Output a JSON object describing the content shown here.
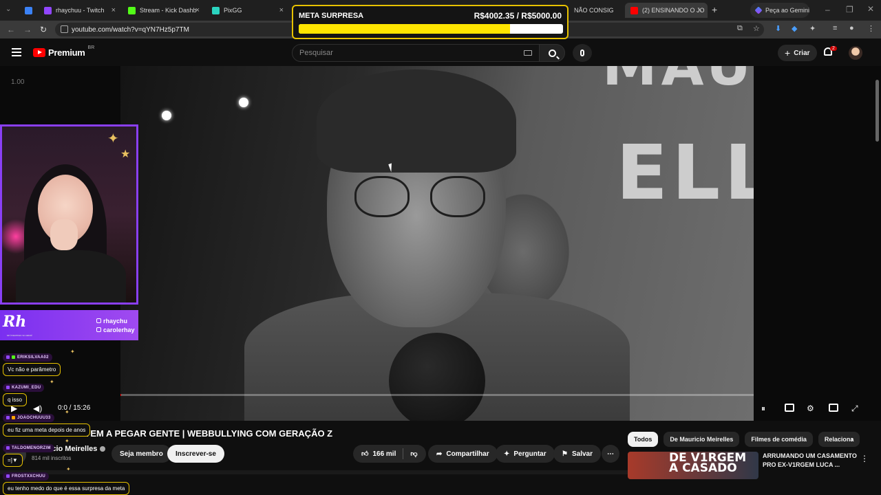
{
  "browser": {
    "tabs": [
      {
        "label": "rhaychuu - Twitch",
        "color": "#9146ff"
      },
      {
        "label": "Stream - Kick Dashb",
        "color": "#53fc18"
      },
      {
        "label": "PixGG",
        "color": "#2bd4c0"
      },
      {
        "label": "NÃO CONSIG",
        "color": "#888888"
      },
      {
        "label": "(2) ENSINANDO O JO",
        "color": "#ff0000"
      }
    ],
    "gemini_label": "Peça ao Gemini",
    "url": "youtube.com/watch?v=qYN7Hz5p7TM"
  },
  "meta": {
    "title": "META SURPRESA",
    "values": "R$4002.35 / R$5000.00",
    "current": 4002.35,
    "goal": 5000.0,
    "accent": "#ffe500"
  },
  "youtube": {
    "logo": "Premium",
    "region": "BR",
    "search_placeholder": "Pesquisar",
    "create_label": "Criar",
    "notif_count": "2"
  },
  "player": {
    "speed": "1.00",
    "time": "0:0  / 15:26",
    "progress_fraction": 0.001,
    "wall_text_top": "MAURI",
    "wall_text": "ELL",
    "watched_icons": [
      "play-icon",
      "volume-icon",
      "autoplay-toggle-icon",
      "subtitles-icon",
      "settings-icon",
      "miniplayer-icon",
      "fullscreen-icon"
    ]
  },
  "stream_overlay": {
    "banner_logo": "Rh",
    "banner_small": "se inscreva no canal",
    "handles": [
      "rhaychu",
      "carolerhay"
    ],
    "border_color": "#8a3ff5"
  },
  "chat": [
    {
      "user": "ERIKSILVAA02",
      "text": "Vc não e parâmetro"
    },
    {
      "user": "KAZUMI_EDU",
      "text": "q isso"
    },
    {
      "user": "JOAOCHUUU33",
      "text": "eu fiz uma meta depois de anos"
    },
    {
      "user": "TALDOMENORZIM",
      "text": "=]▼"
    },
    {
      "user": "FROSTXXCHUU",
      "text": "eu tenho medo do que é essa surpresa da meta"
    }
  ],
  "video": {
    "title": "ENSINANDO O JOVEM A PEGAR GENTE | WEBBULLYING COM GERAÇÃO Z",
    "channel": "Maurício Meirelles",
    "subscribers": "814 mil inscritos",
    "member_label": "Seja membro",
    "subscribe_label": "Inscrever-se",
    "likes": "166 mil",
    "share_label": "Compartilhar",
    "ask_label": "Perguntar",
    "save_label": "Salvar"
  },
  "related": {
    "chips": [
      "Todos",
      "De Mauricio Meirelles",
      "Filmes de comédia",
      "Relaciona"
    ],
    "first_thumb_text": "DE V1RGEM A CASADO",
    "first_title": "ARRUMANDO UM CASAMENTO PRO EX-V1RGEM LUCA ..."
  }
}
